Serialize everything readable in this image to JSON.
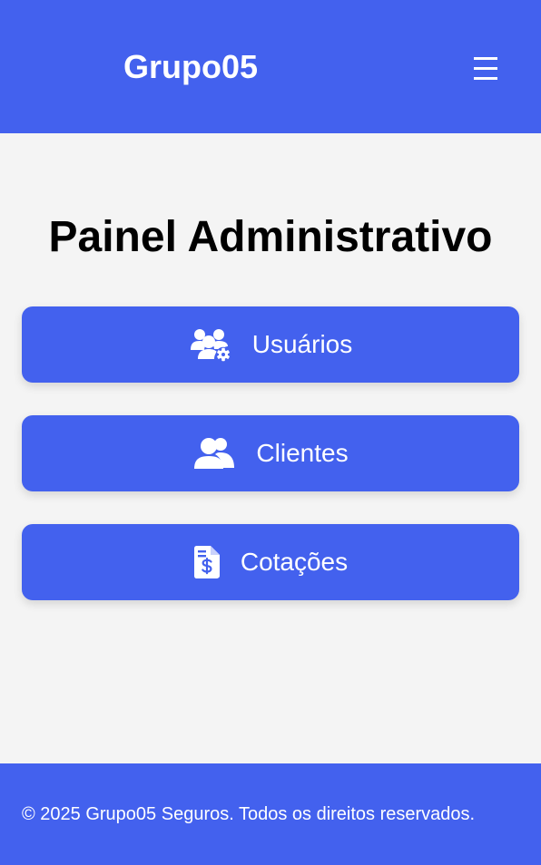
{
  "header": {
    "brand": "Grupo05",
    "menu_icon": "hamburger-icon"
  },
  "main": {
    "title": "Painel Administrativo",
    "buttons": [
      {
        "label": "Usuários",
        "icon": "users-cog-icon"
      },
      {
        "label": "Clientes",
        "icon": "users-icon"
      },
      {
        "label": "Cotações",
        "icon": "invoice-dollar-icon"
      }
    ]
  },
  "footer": {
    "text": "© 2025 Grupo05 Seguros. Todos os direitos reservados."
  },
  "colors": {
    "primary": "#4361ee",
    "background": "#f4f4f4",
    "text_on_primary": "#ffffff"
  }
}
